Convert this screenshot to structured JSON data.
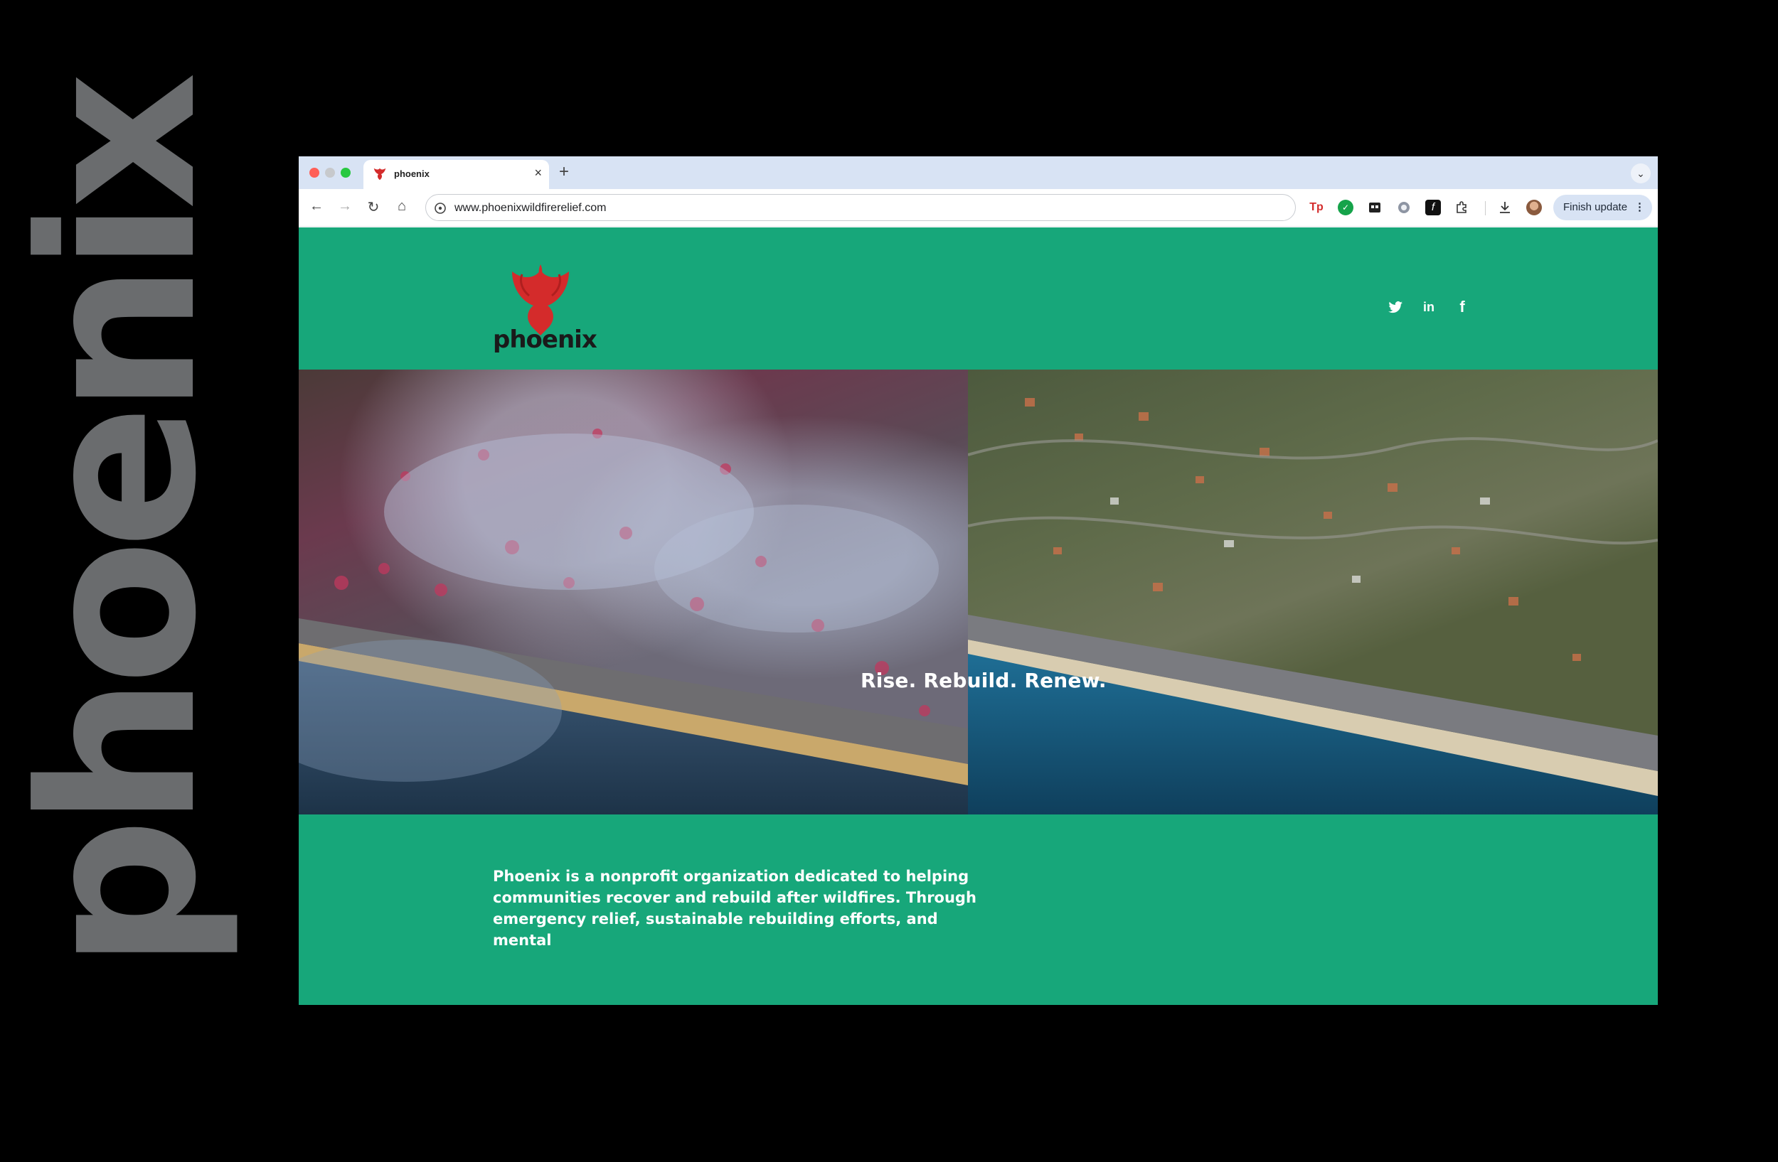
{
  "side_text": "phoenix",
  "browser": {
    "tab_title": "phoenix",
    "new_tab_label": "+",
    "url": "www.phoenixwildfirerelief.com",
    "finish_update_label": "Finish update",
    "ext_tp_label": "Tp"
  },
  "page": {
    "logo_text": "phoenix",
    "social": [
      "twitter-icon",
      "linkedin-icon",
      "facebook-icon"
    ],
    "hero_title": "Rise. Rebuild. Renew.",
    "intro_text": "Phoenix is a nonprofit organization dedicated to helping communities recover and rebuild after wildfires. Through emergency relief, sustainable rebuilding efforts, and mental"
  },
  "colors": {
    "page_green": "#17a77a",
    "logo_red": "#d42b2b",
    "side_text_gray": "#6a6c6e"
  }
}
